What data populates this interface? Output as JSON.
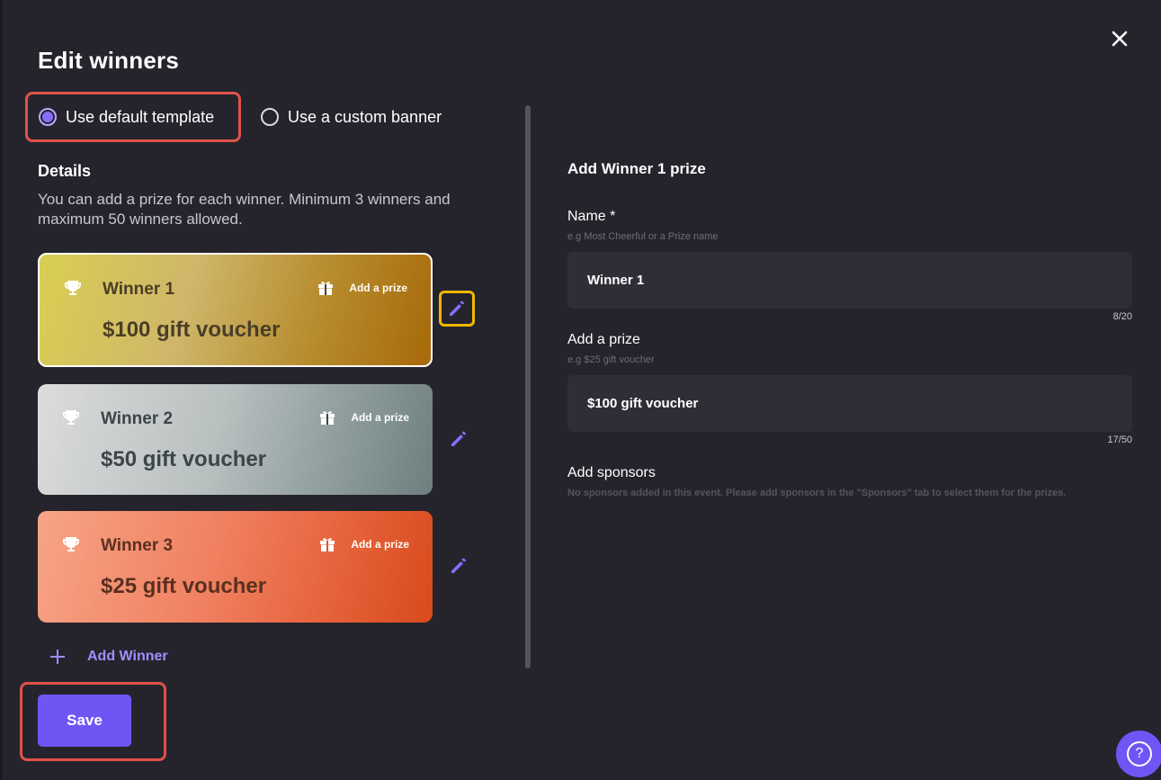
{
  "dialog": {
    "title": "Edit winners",
    "close_icon": "close-icon"
  },
  "template_options": {
    "selected": "default",
    "default_label": "Use default template",
    "custom_label": "Use a custom banner"
  },
  "details": {
    "heading": "Details",
    "description": "You can add a prize for each winner. Minimum 3 winners and maximum 50 winners allowed."
  },
  "winners": [
    {
      "name": "Winner 1",
      "add_prize_label": "Add a prize",
      "prize": "$100 gift voucher",
      "selected": true
    },
    {
      "name": "Winner 2",
      "add_prize_label": "Add a prize",
      "prize": "$50 gift voucher",
      "selected": false
    },
    {
      "name": "Winner 3",
      "add_prize_label": "Add a prize",
      "prize": "$25 gift voucher",
      "selected": false
    }
  ],
  "add_winner_label": "Add Winner",
  "save_label": "Save",
  "form": {
    "title": "Add Winner 1 prize",
    "name": {
      "label": "Name *",
      "hint": "e.g Most Cheerful or a Prize name",
      "value": "Winner 1",
      "counter": "8/20"
    },
    "prize": {
      "label": "Add a prize",
      "hint": "e.g $25 gift voucher",
      "value": "$100 gift voucher",
      "counter": "17/50"
    },
    "sponsors": {
      "label": "Add sponsors",
      "note": "No sponsors added in this event. Please add sponsors in the \"Sponsors\" tab to select them for the prizes."
    }
  },
  "help_label": "?",
  "colors": {
    "background": "#25242c",
    "accent": "#7055f5",
    "accent_text": "#a58cff",
    "highlight_red": "#e0524a",
    "highlight_yellow": "#f0b700",
    "input_bg": "#2f2e37"
  }
}
